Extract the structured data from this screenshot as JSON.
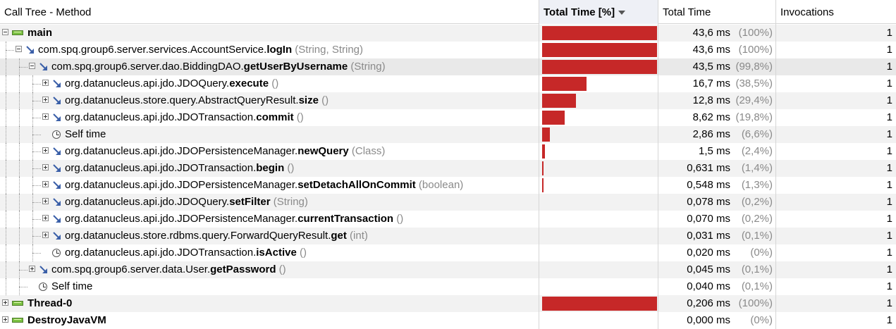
{
  "columns": {
    "call_tree": "Call Tree - Method",
    "total_time_pct": "Total Time [%]",
    "total_time": "Total Time",
    "invocations": "Invocations"
  },
  "colors": {
    "bar": "#c62828"
  },
  "rows": [
    {
      "kind": "thread",
      "label": "main",
      "expander": "minus",
      "time": "43,6 ms",
      "pct": "(100%)",
      "frac": 1.0,
      "inv": "1"
    },
    {
      "kind": "call",
      "cls": "com.spq.group6.server.services.AccountService.",
      "method": "logIn",
      "sig": " (String, String)",
      "expander": "minus",
      "time": "43,6 ms",
      "pct": "(100%)",
      "frac": 1.0,
      "inv": "1"
    },
    {
      "kind": "call",
      "cls": "com.spq.group6.server.dao.BiddingDAO.",
      "method": "getUserByUsername",
      "sig": " (String)",
      "expander": "minus",
      "time": "43,5 ms",
      "pct": "(99,8%)",
      "frac": 0.998,
      "inv": "1",
      "selected": true
    },
    {
      "kind": "call",
      "cls": "org.datanucleus.api.jdo.JDOQuery.",
      "method": "execute",
      "sig": " ()",
      "expander": "plus",
      "time": "16,7 ms",
      "pct": "(38,5%)",
      "frac": 0.385,
      "inv": "1"
    },
    {
      "kind": "call",
      "cls": "org.datanucleus.store.query.AbstractQueryResult.",
      "method": "size",
      "sig": " ()",
      "expander": "plus",
      "time": "12,8 ms",
      "pct": "(29,4%)",
      "frac": 0.294,
      "inv": "1"
    },
    {
      "kind": "call",
      "cls": "org.datanucleus.api.jdo.JDOTransaction.",
      "method": "commit",
      "sig": " ()",
      "expander": "plus",
      "time": "8,62 ms",
      "pct": "(19,8%)",
      "frac": 0.198,
      "inv": "1"
    },
    {
      "kind": "self",
      "label": "Self time",
      "time": "2,86 ms",
      "pct": "(6,6%)",
      "frac": 0.066,
      "inv": "1"
    },
    {
      "kind": "call",
      "cls": "org.datanucleus.api.jdo.JDOPersistenceManager.",
      "method": "newQuery",
      "sig": " (Class)",
      "expander": "plus",
      "time": "1,5 ms",
      "pct": "(2,4%)",
      "frac": 0.024,
      "inv": "1"
    },
    {
      "kind": "call",
      "cls": "org.datanucleus.api.jdo.JDOTransaction.",
      "method": "begin",
      "sig": " ()",
      "expander": "plus",
      "time": "0,631 ms",
      "pct": "(1,4%)",
      "frac": 0.014,
      "inv": "1"
    },
    {
      "kind": "call",
      "cls": "org.datanucleus.api.jdo.JDOPersistenceManager.",
      "method": "setDetachAllOnCommit",
      "sig": " (boolean)",
      "expander": "plus",
      "time": "0,548 ms",
      "pct": "(1,3%)",
      "frac": 0.013,
      "inv": "1"
    },
    {
      "kind": "call",
      "cls": "org.datanucleus.api.jdo.JDOQuery.",
      "method": "setFilter",
      "sig": " (String)",
      "expander": "plus",
      "time": "0,078 ms",
      "pct": "(0,2%)",
      "frac": 0.002,
      "inv": "1"
    },
    {
      "kind": "call",
      "cls": "org.datanucleus.api.jdo.JDOPersistenceManager.",
      "method": "currentTransaction",
      "sig": " ()",
      "expander": "plus",
      "time": "0,070 ms",
      "pct": "(0,2%)",
      "frac": 0.002,
      "inv": "1"
    },
    {
      "kind": "call",
      "cls": "org.datanucleus.store.rdbms.query.ForwardQueryResult.",
      "method": "get",
      "sig": " (int)",
      "expander": "plus",
      "time": "0,031 ms",
      "pct": "(0,1%)",
      "frac": 0.001,
      "inv": "1"
    },
    {
      "kind": "clock-call",
      "cls": "org.datanucleus.api.jdo.JDOTransaction.",
      "method": "isActive",
      "sig": " ()",
      "time": "0,020 ms",
      "pct": "(0%)",
      "frac": 0.0,
      "inv": "1"
    },
    {
      "kind": "call",
      "cls": "com.spq.group6.server.data.User.",
      "method": "getPassword",
      "sig": " ()",
      "expander": "plus",
      "time": "0,045 ms",
      "pct": "(0,1%)",
      "frac": 0.001,
      "inv": "1"
    },
    {
      "kind": "self",
      "label": "Self time",
      "time": "0,040 ms",
      "pct": "(0,1%)",
      "frac": 0.001,
      "inv": "1"
    },
    {
      "kind": "thread",
      "label": "Thread-0",
      "expander": "plus",
      "time": "0,206 ms",
      "pct": "(100%)",
      "frac": 1.0,
      "inv": "1"
    },
    {
      "kind": "thread",
      "label": "DestroyJavaVM",
      "expander": "plus",
      "time": "0,000 ms",
      "pct": "(0%)",
      "frac": 0.0,
      "inv": "1"
    }
  ]
}
